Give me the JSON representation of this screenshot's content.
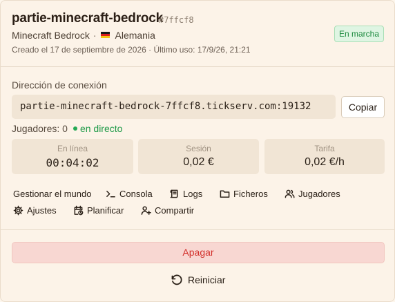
{
  "server": {
    "name": "partie-minecraft-bedrock",
    "hash": "#7ffcf8",
    "edition": "Minecraft Bedrock",
    "separator": "·",
    "country": "Alemania",
    "meta": "Creado el 17 de septiembre de 2026 · Último uso: 17/9/26, 21:21",
    "status": "En marcha"
  },
  "connection": {
    "label": "Dirección de conexión",
    "address": "partie-minecraft-bedrock-7ffcf8.tickserv.com:19132",
    "copy_label": "Copiar"
  },
  "players": {
    "label": "Jugadores: 0",
    "live_label": "en directo"
  },
  "stats": [
    {
      "label": "En línea",
      "value": "00:04:02"
    },
    {
      "label": "Sesión",
      "value": "0,02 €"
    },
    {
      "label": "Tarifa",
      "value": "0,02 €/h"
    }
  ],
  "actions": {
    "manage": "Gestionar el mundo",
    "console": "Consola",
    "logs": "Logs",
    "files": "Ficheros",
    "players": "Jugadores",
    "settings": "Ajustes",
    "schedule": "Planificar",
    "share": "Compartir"
  },
  "controls": {
    "stop": "Apagar",
    "restart": "Reiniciar"
  },
  "icons": {
    "console": "terminal-icon",
    "logs": "scroll-icon",
    "files": "folder-icon",
    "players": "users-icon",
    "settings": "gear-icon",
    "schedule": "calendar-clock-icon",
    "share": "user-plus-icon",
    "restart": "rotate-ccw-icon",
    "flag": "germany-flag-icon"
  },
  "colors": {
    "background": "#fcf3e8",
    "status_green": "#1d8a3f",
    "danger": "#d3302b",
    "danger_bg": "#f8d7d2"
  }
}
